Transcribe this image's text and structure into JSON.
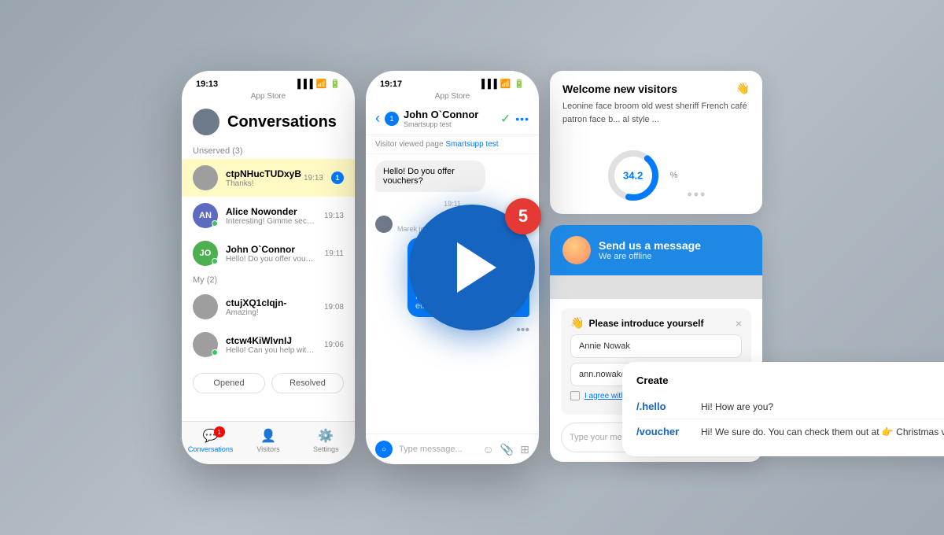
{
  "background": {
    "color": "#b0b8c4"
  },
  "phone1": {
    "status_time": "19:13",
    "store_label": "App Store",
    "title": "Conversations",
    "section_unserved": "Unserved (3)",
    "section_my": "My (2)",
    "conversations": [
      {
        "id": "ctpNHucTUDxyB",
        "name": "ctpNHucTUDxyB",
        "preview": "Thanks!",
        "time": "19:13",
        "highlighted": true,
        "avatar_color": "#9e9e9e",
        "avatar_text": "",
        "badge": "1",
        "online": false
      },
      {
        "id": "alice",
        "name": "Alice Nowonder",
        "preview": "Interesting! Gimme second",
        "time": "19:13",
        "highlighted": false,
        "avatar_color": "#5c6bc0",
        "avatar_text": "AN",
        "badge": "",
        "online": true
      },
      {
        "id": "john",
        "name": "John O`Connor",
        "preview": "Hello! Do you offer vouchers?",
        "time": "19:11",
        "highlighted": false,
        "avatar_color": "#4caf50",
        "avatar_text": "JO",
        "badge": "",
        "online": true
      },
      {
        "id": "ctuj",
        "name": "ctujXQ1cIqjn-",
        "preview": "Amazing!",
        "time": "19:08",
        "highlighted": false,
        "avatar_color": "#9e9e9e",
        "avatar_text": "",
        "badge": "",
        "online": false
      },
      {
        "id": "ctcw",
        "name": "ctcw4KiWlvnIJ",
        "preview": "Hello! Can you help with something?",
        "time": "19:06",
        "highlighted": false,
        "avatar_color": "#9e9e9e",
        "avatar_text": "",
        "badge": "",
        "online": true
      }
    ],
    "tab_opened": "Opened",
    "tab_resolved": "Resolved",
    "tabs": [
      {
        "label": "Conversations",
        "icon": "💬",
        "badge": "1",
        "active": true
      },
      {
        "label": "Visitors",
        "icon": "👤",
        "badge": "",
        "active": false
      },
      {
        "label": "Settings",
        "icon": "⚙️",
        "badge": "",
        "active": false
      }
    ]
  },
  "phone2": {
    "status_time": "19:17",
    "store_label": "App Store",
    "contact_name": "John O`Connor",
    "contact_sub": "Smartsupp test",
    "badge_num": "1",
    "visitor_notice": "Visitor viewed page",
    "visitor_link": "Smartsupp test",
    "messages": [
      {
        "type": "visitor",
        "text": "Hello! Do you offer vouchers?",
        "time": ""
      },
      {
        "type": "time",
        "text": "19:11"
      },
      {
        "type": "system",
        "text": "Marek joined  19..."
      },
      {
        "type": "agent",
        "text": "Hi! We sure do. You can check them out at Christmas vouchers (webshop.com/vo... We can also wrap a gift 🎉 May I help you something else?"
      }
    ],
    "input_placeholder": "Type message...",
    "dots_more": "..."
  },
  "welcome_panel": {
    "title": "Welcome new visitors",
    "hand_icon": "👋",
    "text": "Leonine face broom old west sheriff French café patron face b... al style ...",
    "chart_value": "34.2",
    "chart_percent": "%"
  },
  "chat_widget": {
    "header_title": "Send us a message",
    "header_status": "We are offline",
    "intro_hand": "👋",
    "intro_title": "Please introduce yourself",
    "field1_value": "Annie Nowak",
    "field2_value": "ann.nowak@gmail.com",
    "privacy_text": "I agree with privacy policy",
    "input_placeholder": "Type your message here",
    "send_icon": "▶"
  },
  "shortcuts_panel": {
    "title": "Create",
    "shortcuts": [
      {
        "cmd": "/.hello",
        "text": "Hi! How are you?"
      },
      {
        "cmd": "/voucher",
        "text": "Hi! We sure do. You can check them out at 👉 Christmas vouchers (webshop...."
      }
    ]
  },
  "play_button": {
    "episode": "5"
  }
}
